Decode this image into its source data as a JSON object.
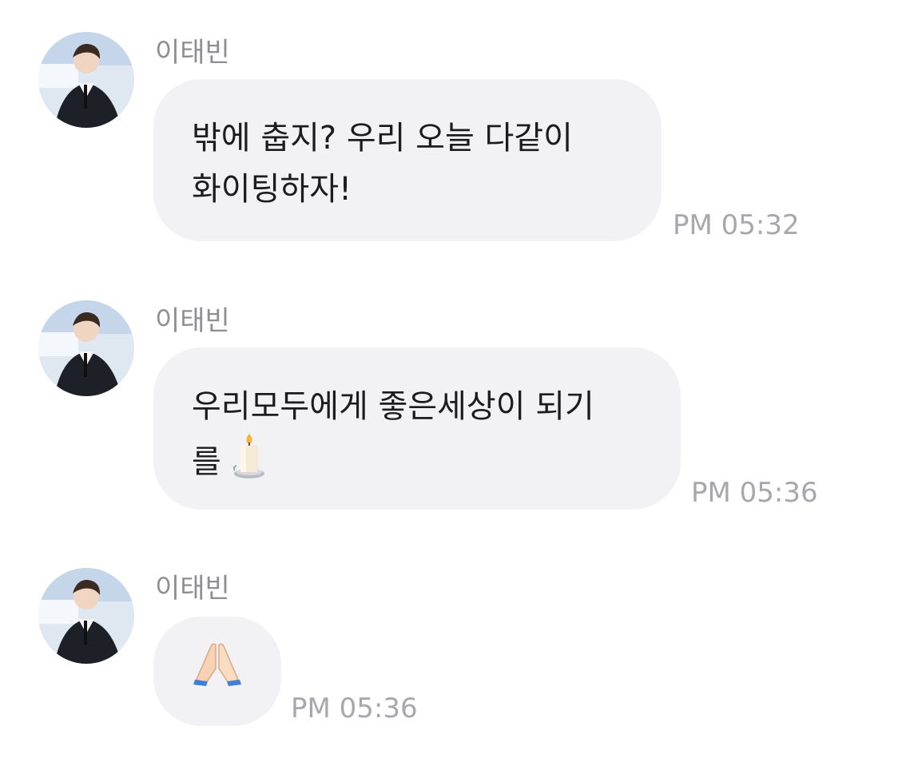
{
  "messages": [
    {
      "sender": "이태빈",
      "lines": [
        "밖에 춥지? 우리 오늘 다같이",
        "화이팅하자!"
      ],
      "time": "PM 05:32"
    },
    {
      "sender": "이태빈",
      "lines": [
        "우리모두에게 좋은세상이 되기",
        "를"
      ],
      "emoji": "candle-icon",
      "time": "PM 05:36"
    },
    {
      "sender": "이태빈",
      "emoji": "folded-hands-icon",
      "time": "PM 05:36"
    }
  ],
  "colors": {
    "bubble": "#f2f2f5",
    "sender_text": "#8e8e93",
    "time_text": "#a7a7ad",
    "message_text": "#1c1c1e"
  }
}
